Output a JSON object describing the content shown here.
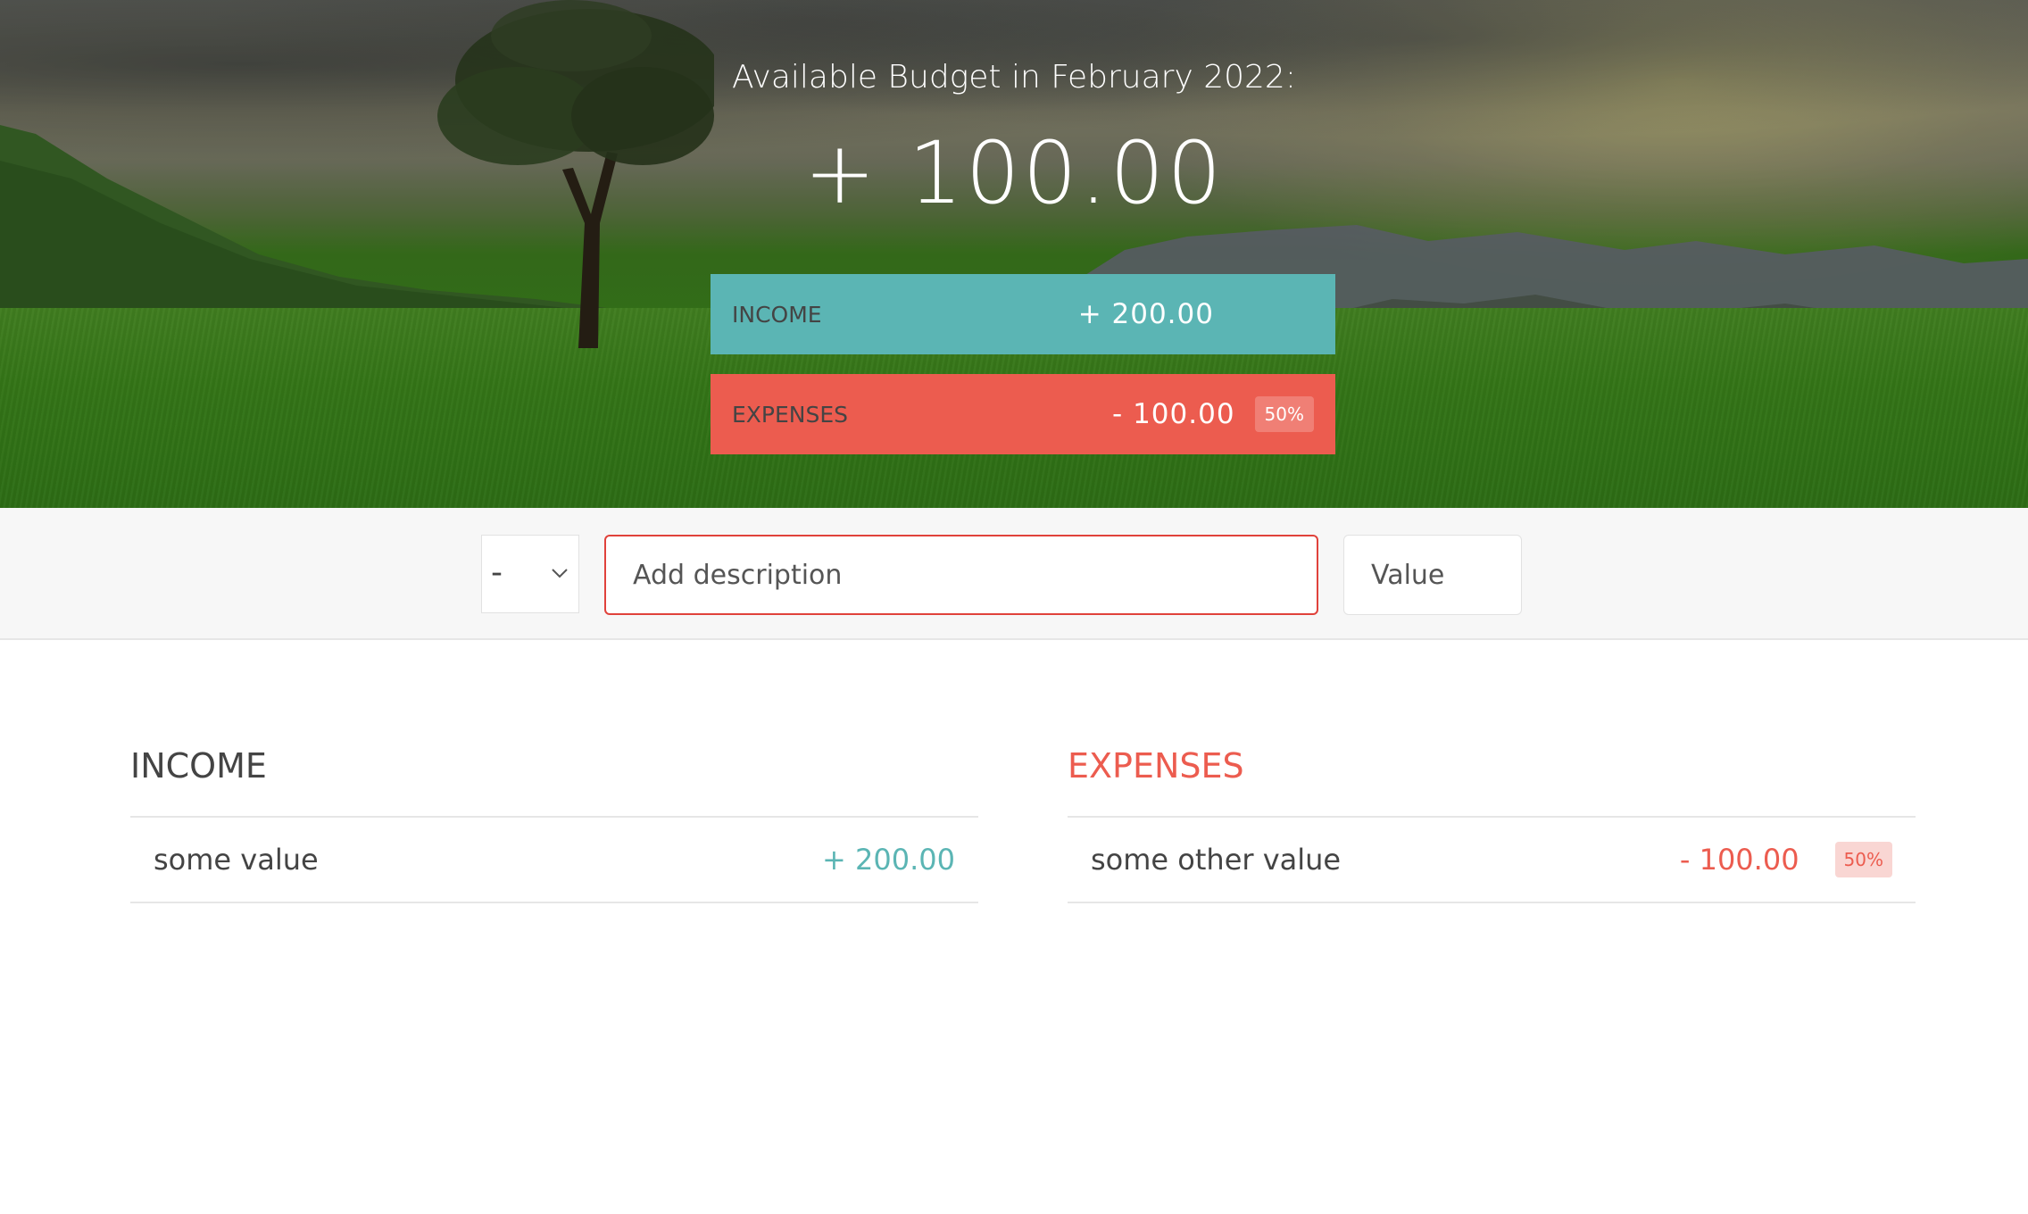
{
  "budget": {
    "title": "Available Budget in February 2022:",
    "value": "+ 100.00",
    "income_label": "Income",
    "income_value": "+ 200.00",
    "expenses_label": "Expenses",
    "expenses_value": "- 100.00",
    "expenses_percentage": "50%"
  },
  "add_form": {
    "type_selected": "-",
    "description_placeholder": "Add description",
    "value_placeholder": "Value"
  },
  "income_list": {
    "title": "Income",
    "items": [
      {
        "description": "some value",
        "value": "+ 200.00"
      }
    ]
  },
  "expenses_list": {
    "title": "Expenses",
    "items": [
      {
        "description": "some other value",
        "value": "- 100.00",
        "percentage": "50%"
      }
    ]
  },
  "colors": {
    "income": "#5bb5b4",
    "expenses": "#ec5c4f",
    "focus_border": "#e0423b"
  }
}
